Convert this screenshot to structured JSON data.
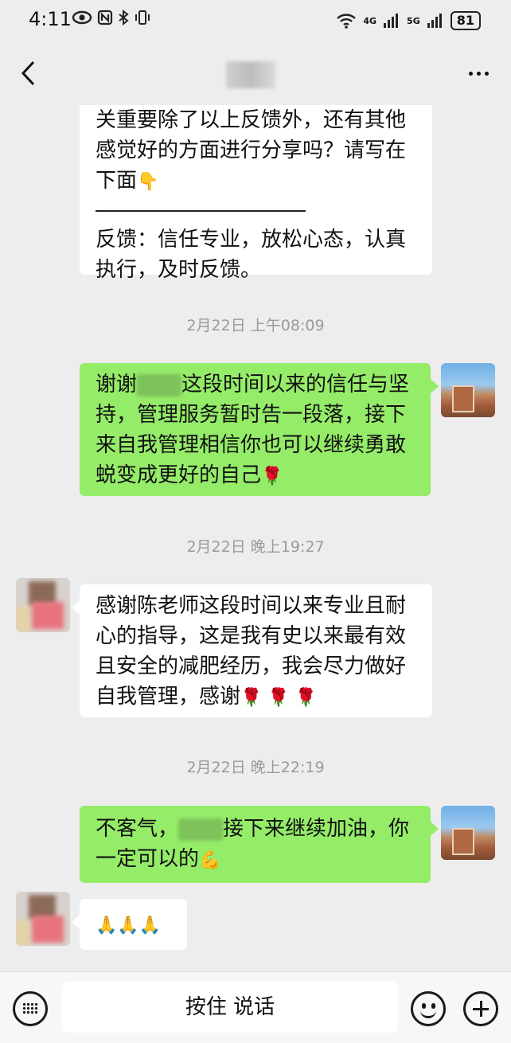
{
  "status_bar": {
    "time": "4:11",
    "signal_4g": "4G",
    "signal_5g": "5G",
    "battery": "81",
    "icons": [
      "eye-icon",
      "nfc-icon",
      "bluetooth-icon",
      "vibrate-icon",
      "wifi-icon",
      "signal-icon"
    ]
  },
  "nav": {
    "back_icon": "chevron-left-icon",
    "title_blurred": true,
    "more_icon": "more-dots-icon"
  },
  "messages": {
    "m1": {
      "line1": "关重要除了以上反馈外，还有其他",
      "line2": "感觉好的方面进行分享吗？请写在",
      "line3": "下面",
      "line3_emoji": "👇",
      "line4": "反馈：信任专业，放松心态，认真",
      "line5": "执行，及时反馈。"
    },
    "ts1": "2月22日 上午08:09",
    "m2": {
      "line1_a": "谢谢",
      "line1_b": "这段时间以来的信任与坚",
      "line2": "持，管理服务暂时告一段落，接下",
      "line3": "来自我管理相信你也可以继续勇敢",
      "line4": "蜕变成更好的自己",
      "line4_emoji": "🌹"
    },
    "ts2": "2月22日 晚上19:27",
    "m3": {
      "line1": "感谢陈老师这段时间以来专业且耐",
      "line2": "心的指导，这是我有史以来最有效",
      "line3": "且安全的减肥经历，我会尽力做好",
      "line4": "自我管理，感谢",
      "line4_emoji": "🌹 🌹 🌹"
    },
    "ts3": "2月22日 晚上22:19",
    "m4": {
      "line1_a": "不客气，",
      "line1_b": "接下来继续加油，你",
      "line2": "一定可以的",
      "line2_emoji": "💪"
    },
    "m5": {
      "emoji": "🙏🙏🙏"
    }
  },
  "input_bar": {
    "keyboard_icon": "keyboard-icon",
    "hold_to_talk": "按住 说话",
    "emoji_icon": "smiley-icon",
    "plus_icon": "plus-icon"
  },
  "colors": {
    "background": "#ededed",
    "outgoing_bubble": "#95ec69",
    "incoming_bubble": "#ffffff",
    "timestamp_text": "#9a9a9a"
  }
}
